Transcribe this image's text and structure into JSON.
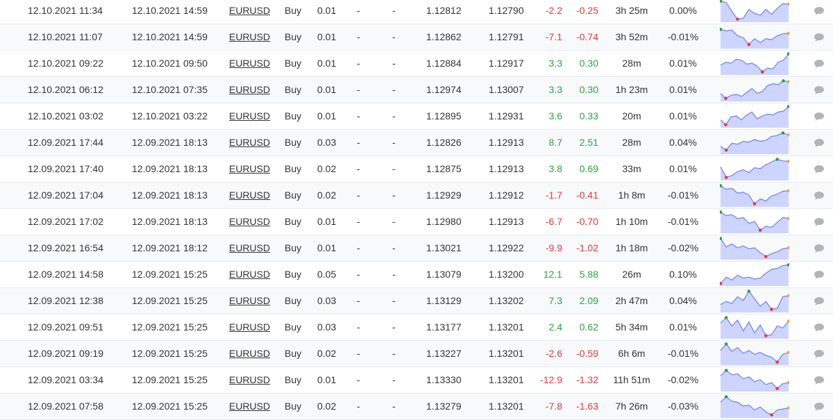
{
  "colors": {
    "profit": "#2ea043",
    "loss": "#e5383b",
    "spark_line": "#7d8ce8",
    "spark_fill": "#cdd5ff",
    "spark_max_dot": "#2ea043",
    "spark_min_dot": "#e5383b",
    "spark_end_dot": "#f0a04b",
    "comment_icon": "#b0b5bc"
  },
  "rows": [
    {
      "open": "12.10.2021 11:34",
      "close": "12.10.2021 14:59",
      "symbol": "EURUSD",
      "type": "Buy",
      "lots": "0.01",
      "sl": "-",
      "tp": "-",
      "open_price": "1.12812",
      "close_price": "1.12790",
      "pips": "-2.2",
      "profit": "-0.25",
      "duration": "3h 25m",
      "gain": "0.00%",
      "sign": "neg",
      "spark": [
        0.98,
        0.9,
        0.45,
        0.05,
        0.1,
        0.55,
        0.35,
        0.25,
        0.55,
        0.3,
        0.6,
        0.85,
        0.82
      ]
    },
    {
      "open": "12.10.2021 11:07",
      "close": "12.10.2021 14:59",
      "symbol": "EURUSD",
      "type": "Buy",
      "lots": "0.01",
      "sl": "-",
      "tp": "-",
      "open_price": "1.12862",
      "close_price": "1.12791",
      "pips": "-7.1",
      "profit": "-0.74",
      "duration": "3h 52m",
      "gain": "-0.01%",
      "sign": "neg",
      "spark": [
        0.88,
        0.8,
        0.85,
        0.55,
        0.45,
        0.1,
        0.4,
        0.2,
        0.4,
        0.35,
        0.55,
        0.65,
        0.68
      ]
    },
    {
      "open": "12.10.2021 09:22",
      "close": "12.10.2021 09:50",
      "symbol": "EURUSD",
      "type": "Buy",
      "lots": "0.01",
      "sl": "-",
      "tp": "-",
      "open_price": "1.12884",
      "close_price": "1.12917",
      "pips": "3.3",
      "profit": "0.30",
      "duration": "28m",
      "gain": "0.01%",
      "sign": "pos",
      "spark": [
        0.4,
        0.55,
        0.5,
        0.7,
        0.65,
        0.45,
        0.5,
        0.35,
        0.05,
        0.25,
        0.2,
        0.55,
        0.65,
        0.98
      ]
    },
    {
      "open": "12.10.2021 06:12",
      "close": "12.10.2021 07:35",
      "symbol": "EURUSD",
      "type": "Buy",
      "lots": "0.01",
      "sl": "-",
      "tp": "-",
      "open_price": "1.12974",
      "close_price": "1.13007",
      "pips": "3.3",
      "profit": "0.30",
      "duration": "1h 23m",
      "gain": "0.01%",
      "sign": "pos",
      "spark": [
        0.3,
        0.05,
        0.2,
        0.25,
        0.15,
        0.35,
        0.55,
        0.3,
        0.4,
        0.7,
        0.8,
        0.75,
        0.95,
        0.9
      ]
    },
    {
      "open": "12.10.2021 03:02",
      "close": "12.10.2021 03:22",
      "symbol": "EURUSD",
      "type": "Buy",
      "lots": "0.01",
      "sl": "-",
      "tp": "-",
      "open_price": "1.12895",
      "close_price": "1.12931",
      "pips": "3.6",
      "profit": "0.33",
      "duration": "20m",
      "gain": "0.01%",
      "sign": "pos",
      "spark": [
        0.3,
        0.05,
        0.45,
        0.5,
        0.3,
        0.55,
        0.7,
        0.35,
        0.5,
        0.6,
        0.55,
        0.7,
        0.75,
        0.98
      ]
    },
    {
      "open": "12.09.2021 17:44",
      "close": "12.09.2021 18:13",
      "symbol": "EURUSD",
      "type": "Buy",
      "lots": "0.03",
      "sl": "-",
      "tp": "-",
      "open_price": "1.12826",
      "close_price": "1.12913",
      "pips": "8.7",
      "profit": "2.51",
      "duration": "28m",
      "gain": "0.04%",
      "sign": "pos",
      "spark": [
        0.3,
        0.1,
        0.45,
        0.4,
        0.55,
        0.5,
        0.65,
        0.55,
        0.6,
        0.8,
        0.85,
        0.98,
        0.88
      ]
    },
    {
      "open": "12.09.2021 17:40",
      "close": "12.09.2021 18:13",
      "symbol": "EURUSD",
      "type": "Buy",
      "lots": "0.02",
      "sl": "-",
      "tp": "-",
      "open_price": "1.12875",
      "close_price": "1.12913",
      "pips": "3.8",
      "profit": "0.69",
      "duration": "33m",
      "gain": "0.01%",
      "sign": "pos",
      "spark": [
        0.6,
        0.05,
        0.15,
        0.35,
        0.45,
        0.3,
        0.55,
        0.5,
        0.7,
        0.85,
        0.98,
        0.9,
        0.88
      ]
    },
    {
      "open": "12.09.2021 17:04",
      "close": "12.09.2021 18:13",
      "symbol": "EURUSD",
      "type": "Buy",
      "lots": "0.02",
      "sl": "-",
      "tp": "-",
      "open_price": "1.12929",
      "close_price": "1.12912",
      "pips": "-1.7",
      "profit": "-0.41",
      "duration": "1h 8m",
      "gain": "-0.01%",
      "sign": "neg",
      "spark": [
        0.98,
        0.8,
        0.85,
        0.6,
        0.65,
        0.5,
        0.05,
        0.3,
        0.2,
        0.45,
        0.55,
        0.7,
        0.72
      ]
    },
    {
      "open": "12.09.2021 17:02",
      "close": "12.09.2021 18:13",
      "symbol": "EURUSD",
      "type": "Buy",
      "lots": "0.01",
      "sl": "-",
      "tp": "-",
      "open_price": "1.12980",
      "close_price": "1.12913",
      "pips": "-6.7",
      "profit": "-0.70",
      "duration": "1h 10m",
      "gain": "-0.01%",
      "sign": "neg",
      "spark": [
        0.98,
        0.8,
        0.85,
        0.65,
        0.7,
        0.4,
        0.5,
        0.05,
        0.25,
        0.2,
        0.45,
        0.7,
        0.65
      ]
    },
    {
      "open": "12.09.2021 16:54",
      "close": "12.09.2021 18:12",
      "symbol": "EURUSD",
      "type": "Buy",
      "lots": "0.01",
      "sl": "-",
      "tp": "-",
      "open_price": "1.13021",
      "close_price": "1.12922",
      "pips": "-9.9",
      "profit": "-1.02",
      "duration": "1h 18m",
      "gain": "-0.02%",
      "sign": "neg",
      "spark": [
        0.98,
        0.55,
        0.7,
        0.5,
        0.6,
        0.45,
        0.5,
        0.25,
        0.05,
        0.2,
        0.3,
        0.45,
        0.5
      ]
    },
    {
      "open": "12.09.2021 14:58",
      "close": "12.09.2021 15:25",
      "symbol": "EURUSD",
      "type": "Buy",
      "lots": "0.05",
      "sl": "-",
      "tp": "-",
      "open_price": "1.13079",
      "close_price": "1.13200",
      "pips": "12.1",
      "profit": "5.88",
      "duration": "26m",
      "gain": "0.10%",
      "sign": "pos",
      "spark": [
        0.02,
        0.35,
        0.2,
        0.45,
        0.3,
        0.35,
        0.25,
        0.3,
        0.55,
        0.75,
        0.8,
        0.95,
        0.98
      ]
    },
    {
      "open": "12.09.2021 12:38",
      "close": "12.09.2021 15:25",
      "symbol": "EURUSD",
      "type": "Buy",
      "lots": "0.03",
      "sl": "-",
      "tp": "-",
      "open_price": "1.13129",
      "close_price": "1.13202",
      "pips": "7.3",
      "profit": "2.09",
      "duration": "2h 47m",
      "gain": "0.04%",
      "sign": "pos",
      "spark": [
        0.3,
        0.45,
        0.35,
        0.7,
        0.5,
        0.98,
        0.6,
        0.2,
        0.45,
        0.05,
        0.1,
        0.7,
        0.75
      ]
    },
    {
      "open": "12.09.2021 09:51",
      "close": "12.09.2021 15:25",
      "symbol": "EURUSD",
      "type": "Buy",
      "lots": "0.03",
      "sl": "-",
      "tp": "-",
      "open_price": "1.13177",
      "close_price": "1.13201",
      "pips": "2.4",
      "profit": "0.62",
      "duration": "5h 34m",
      "gain": "0.01%",
      "sign": "pos",
      "spark": [
        0.7,
        0.98,
        0.55,
        0.85,
        0.3,
        0.75,
        0.2,
        0.6,
        0.05,
        0.1,
        0.55,
        0.45,
        0.8
      ]
    },
    {
      "open": "12.09.2021 09:19",
      "close": "12.09.2021 15:25",
      "symbol": "EURUSD",
      "type": "Buy",
      "lots": "0.02",
      "sl": "-",
      "tp": "-",
      "open_price": "1.13227",
      "close_price": "1.13201",
      "pips": "-2.6",
      "profit": "-0.59",
      "duration": "6h 6m",
      "gain": "-0.01%",
      "sign": "neg",
      "spark": [
        0.65,
        0.98,
        0.6,
        0.8,
        0.5,
        0.65,
        0.45,
        0.55,
        0.4,
        0.3,
        0.05,
        0.45,
        0.55
      ]
    },
    {
      "open": "12.09.2021 03:34",
      "close": "12.09.2021 15:25",
      "symbol": "EURUSD",
      "type": "Buy",
      "lots": "0.01",
      "sl": "-",
      "tp": "-",
      "open_price": "1.13330",
      "close_price": "1.13201",
      "pips": "-12.9",
      "profit": "-1.32",
      "duration": "11h 51m",
      "gain": "-0.02%",
      "sign": "neg",
      "spark": [
        0.7,
        0.98,
        0.75,
        0.8,
        0.55,
        0.65,
        0.4,
        0.5,
        0.25,
        0.35,
        0.05,
        0.3,
        0.35
      ]
    },
    {
      "open": "12.09.2021 07:58",
      "close": "12.09.2021 15:25",
      "symbol": "EURUSD",
      "type": "Buy",
      "lots": "0.02",
      "sl": "-",
      "tp": "-",
      "open_price": "1.13279",
      "close_price": "1.13201",
      "pips": "-7.8",
      "profit": "-1.63",
      "duration": "7h 26m",
      "gain": "-0.03%",
      "sign": "neg",
      "spark": [
        0.7,
        0.98,
        0.75,
        0.7,
        0.5,
        0.55,
        0.3,
        0.45,
        0.2,
        0.05,
        0.3,
        0.35,
        0.4
      ]
    }
  ]
}
